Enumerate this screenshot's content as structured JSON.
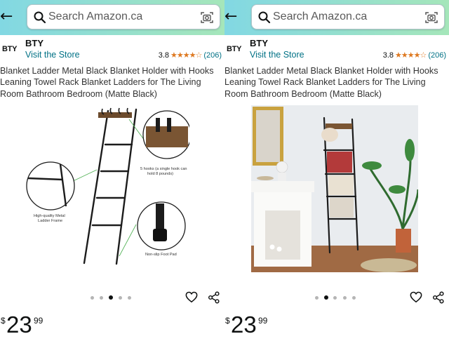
{
  "panels": [
    {
      "search": {
        "placeholder": "Search Amazon.ca"
      },
      "brand": {
        "logo_text": "BTY",
        "name": "BTY",
        "visit_store": "Visit the Store"
      },
      "rating": {
        "value": "3.8",
        "stars": "★★★★☆",
        "count": "(206)"
      },
      "title": "Blanket Ladder Metal Black Blanket Holder with Hooks Leaning Towel Rack Blanket Ladders for The Living Room Bathroom Bedroom (Matte Black)",
      "image": {
        "callout_hooks": [
          "5 hooks (a single hook can",
          "hold 8 pounds)"
        ],
        "callout_frame": [
          "High-quality Metal",
          "Ladder Frame"
        ],
        "callout_pad": "Non-slip Foot Pad"
      },
      "carousel": {
        "count": 5,
        "active_index": 2
      },
      "price": {
        "currency": "$",
        "whole": "23",
        "cents": "99"
      }
    },
    {
      "search": {
        "placeholder": "Search Amazon.ca"
      },
      "brand": {
        "logo_text": "BTY",
        "name": "BTY",
        "visit_store": "Visit the Store"
      },
      "rating": {
        "value": "3.8",
        "stars": "★★★★☆",
        "count": "(206)"
      },
      "title": "Blanket Ladder Metal Black Blanket Holder with Hooks Leaning Towel Rack Blanket Ladders for The Living Room Bathroom Bedroom (Matte Black)",
      "carousel": {
        "count": 5,
        "active_index": 1
      },
      "price": {
        "currency": "$",
        "whole": "23",
        "cents": "99"
      }
    }
  ],
  "icons": {
    "back": "back-arrow-icon",
    "search": "search-icon",
    "camera": "camera-scan-icon",
    "heart": "heart-icon",
    "share": "share-icon"
  },
  "colors": {
    "header_gradient_start": "#82d8e3",
    "header_gradient_end": "#a5e6ba",
    "link": "#007185",
    "star": "#de7921"
  }
}
